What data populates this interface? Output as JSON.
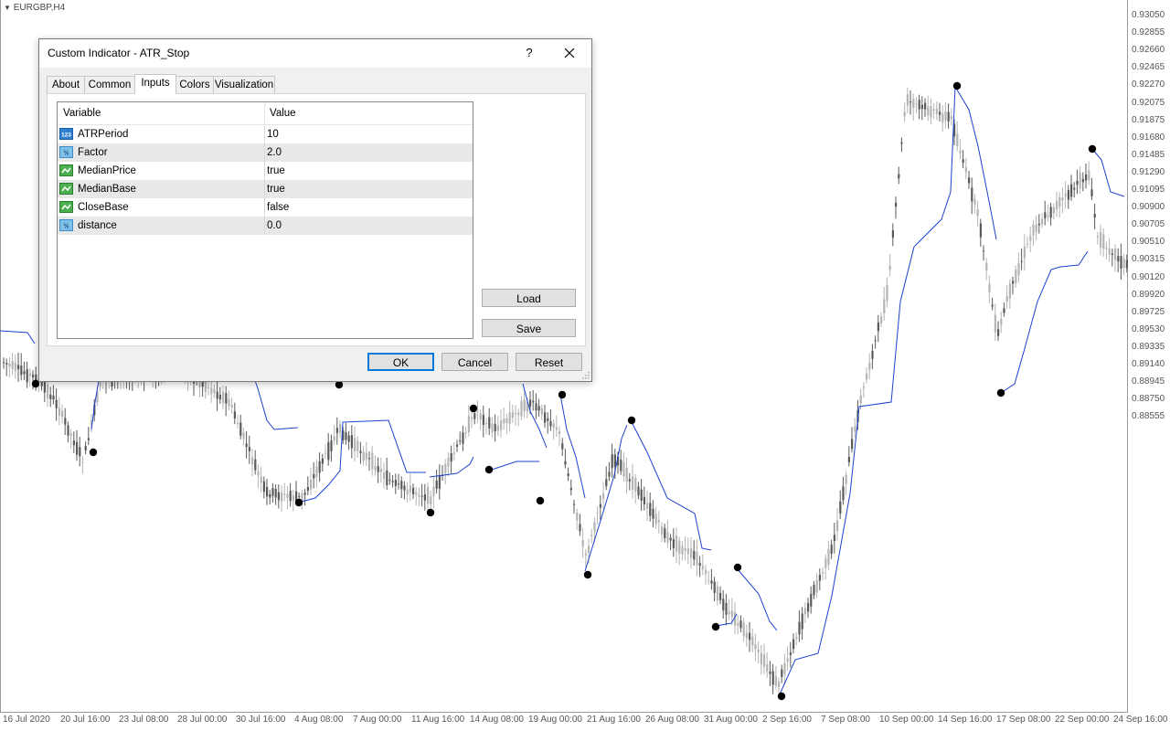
{
  "chart": {
    "symbol_label": "EURGBP,H4",
    "price_scale": [
      "0.93050",
      "0.92855",
      "0.92660",
      "0.92465",
      "0.92270",
      "0.92075",
      "0.91875",
      "0.91680",
      "0.91485",
      "0.91290",
      "0.91095",
      "0.90900",
      "0.90705",
      "0.90510",
      "0.90315",
      "0.90120",
      "0.89920",
      "0.89725",
      "0.89530",
      "0.89335",
      "0.89140",
      "0.88945",
      "0.88750",
      "0.88555"
    ],
    "time_scale": [
      "16 Jul 2020",
      "20 Jul 16:00",
      "23 Jul 08:00",
      "28 Jul 00:00",
      "30 Jul 16:00",
      "4 Aug 08:00",
      "7 Aug 00:00",
      "11 Aug 16:00",
      "14 Aug 08:00",
      "19 Aug 00:00",
      "21 Aug 16:00",
      "26 Aug 08:00",
      "31 Aug 00:00",
      "2 Sep 16:00",
      "7 Sep 08:00",
      "10 Sep 00:00",
      "14 Sep 16:00",
      "17 Sep 08:00",
      "22 Sep 00:00",
      "24 Sep 16:00"
    ],
    "colors": {
      "bull": "#b4b4b4",
      "bear": "#5a5a5a",
      "stop_line": "#1f3fd0",
      "signal_dot": "#000000"
    }
  },
  "dialog": {
    "title": "Custom Indicator - ATR_Stop",
    "help_label": "?",
    "close_icon": "close-icon",
    "tabs": [
      {
        "label": "About"
      },
      {
        "label": "Common"
      },
      {
        "label": "Inputs",
        "active": true
      },
      {
        "label": "Colors"
      },
      {
        "label": "Visualization"
      }
    ],
    "grid": {
      "col_variable": "Variable",
      "col_value": "Value",
      "rows": [
        {
          "icon": "integer-icon",
          "name": "ATRPeriod",
          "value": "10"
        },
        {
          "icon": "double-icon",
          "name": "Factor",
          "value": "2.0"
        },
        {
          "icon": "bool-icon",
          "name": "MedianPrice",
          "value": "true"
        },
        {
          "icon": "bool-icon",
          "name": "MedianBase",
          "value": "true"
        },
        {
          "icon": "bool-icon",
          "name": "CloseBase",
          "value": "false"
        },
        {
          "icon": "double-icon",
          "name": "distance",
          "value": "0.0"
        }
      ]
    },
    "load_label": "Load",
    "save_label": "Save",
    "ok_label": "OK",
    "cancel_label": "Cancel",
    "reset_label": "Reset"
  }
}
